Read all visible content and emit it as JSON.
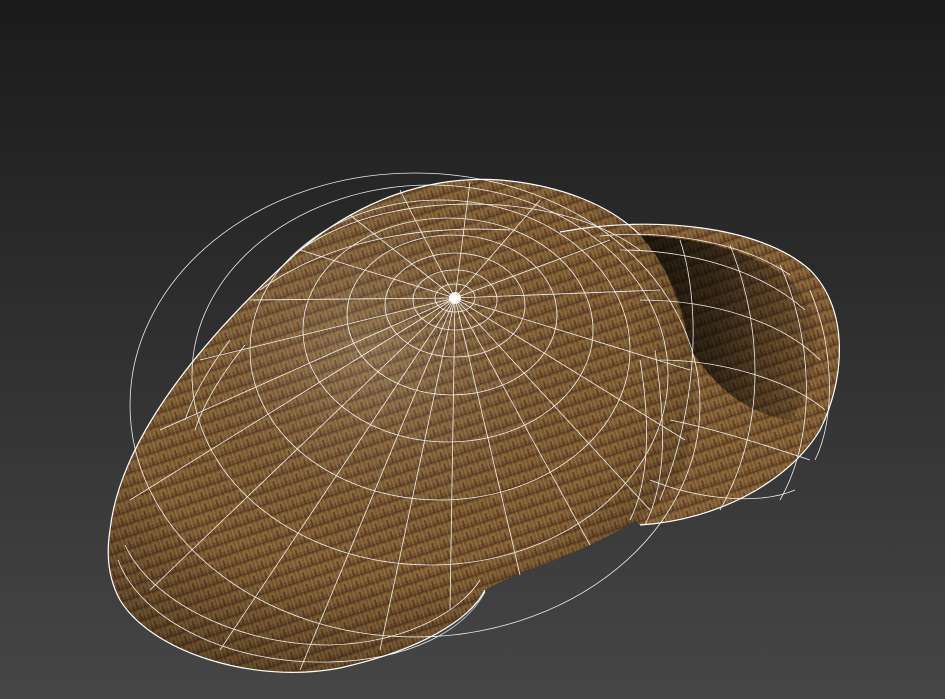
{
  "viewport": {
    "background_top": "#1b1b1b",
    "background_bottom": "#464646"
  },
  "model": {
    "name": "deerstalker-hat",
    "display_mode": "textured-with-wireframe",
    "fabric_base_color": "#7a5a32",
    "fabric_stripe_color": "#5a2f20",
    "fabric_highlight_color": "#b08a50",
    "wire_color": "#ffffff"
  }
}
